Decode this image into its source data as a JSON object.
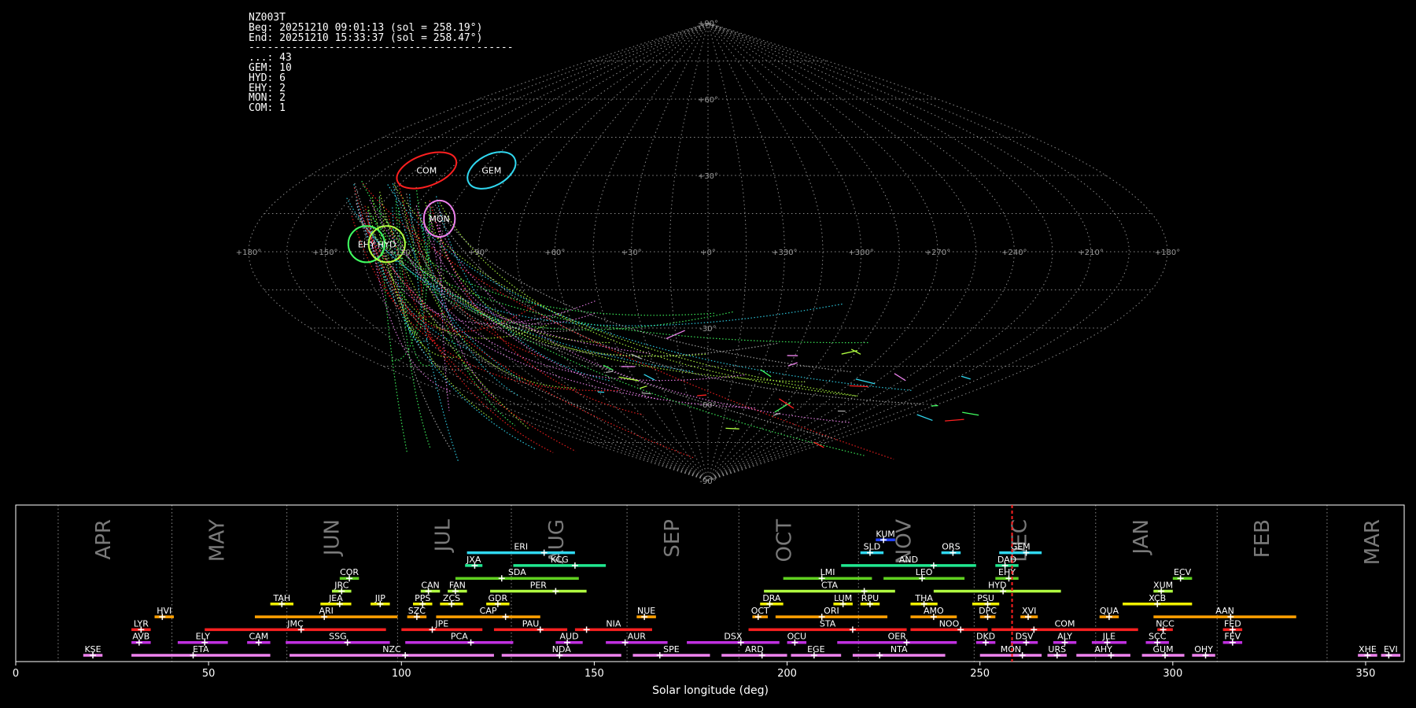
{
  "stats": {
    "camera": "NZ003T",
    "begin": "Beg: 20251210 09:01:13 (sol = 258.19°)",
    "end": "End: 20251210 15:33:37 (sol = 258.47°)",
    "separator": "-------------------------------------------",
    "counts": [
      {
        "label": "...: 43"
      },
      {
        "label": "GEM: 10"
      },
      {
        "label": "HYD: 6"
      },
      {
        "label": "EHY: 2"
      },
      {
        "label": "MON: 2"
      },
      {
        "label": "COM: 1"
      }
    ]
  },
  "chart_data": [
    {
      "type": "scatter",
      "projection": "sinusoidal",
      "lon_ticks": [
        {
          "lon": 180,
          "label": "+180°"
        },
        {
          "lon": 150,
          "label": "+150°"
        },
        {
          "lon": 120,
          "label": "+120°"
        },
        {
          "lon": 90,
          "label": "+90°"
        },
        {
          "lon": 60,
          "label": "+60°"
        },
        {
          "lon": 30,
          "label": "+30°"
        },
        {
          "lon": 0,
          "label": "+0°"
        },
        {
          "lon": -30,
          "label": "+330°"
        },
        {
          "lon": -60,
          "label": "+300°"
        },
        {
          "lon": -90,
          "label": "+270°"
        },
        {
          "lon": -120,
          "label": "+240°"
        },
        {
          "lon": -150,
          "label": "+210°"
        },
        {
          "lon": -180,
          "label": "+180°"
        }
      ],
      "lat_ticks": [
        {
          "lat": 90,
          "label": "+90°"
        },
        {
          "lat": 60,
          "label": "+60°"
        },
        {
          "lat": 30,
          "label": "+30°"
        },
        {
          "lat": -30,
          "label": "-30°"
        },
        {
          "lat": -60,
          "label": "-60°"
        },
        {
          "lat": -90,
          "label": "-90°"
        }
      ],
      "radiants": [
        {
          "name": "COM",
          "lon": 130,
          "lat": 32,
          "rx": 12,
          "ry": 6,
          "color": "#ff2020"
        },
        {
          "name": "GEM",
          "lon": 100,
          "lat": 32,
          "rx": 10,
          "ry": 6,
          "color": "#30d8f0"
        },
        {
          "name": "MON",
          "lon": 108,
          "lat": 13,
          "rx": 6,
          "ry": 7,
          "color": "#ee82ee"
        },
        {
          "name": "EHY",
          "lon": 134,
          "lat": 3,
          "rx": 7,
          "ry": 7,
          "color": "#40ff60"
        },
        {
          "name": "HYD",
          "lon": 126,
          "lat": 3,
          "rx": 7,
          "ry": 7,
          "color": "#b0ff40"
        }
      ],
      "meteor_colors": [
        "#30d8f0",
        "#b0ff40",
        "#40ff60",
        "#ee82ee",
        "#ff2020",
        "#aaaaaa"
      ]
    },
    {
      "type": "bar",
      "xlabel": "Solar longitude (deg)",
      "xlim": [
        0,
        360
      ],
      "x_ticks": [
        0,
        50,
        100,
        150,
        200,
        250,
        300,
        350
      ],
      "current_sol": 258.33,
      "months": [
        {
          "name": "APR",
          "start": 11
        },
        {
          "name": "MAY",
          "start": 40.5
        },
        {
          "name": "JUN",
          "start": 70.3
        },
        {
          "name": "JUL",
          "start": 99
        },
        {
          "name": "AUG",
          "start": 128.5
        },
        {
          "name": "SEP",
          "start": 158.5
        },
        {
          "name": "OCT",
          "start": 187.5
        },
        {
          "name": "NOV",
          "start": 218.5
        },
        {
          "name": "DEC",
          "start": 248.5
        },
        {
          "name": "JAN",
          "start": 280
        },
        {
          "name": "FEB",
          "start": 311.5
        },
        {
          "name": "MAR",
          "start": 340
        }
      ],
      "showers": [
        {
          "code": "KUM",
          "start": 223,
          "end": 228,
          "peak": 225,
          "row": 9,
          "color": "#2040ff"
        },
        {
          "code": "ERI",
          "start": 117,
          "end": 145,
          "peak": 137,
          "row": 8,
          "color": "#30d8f0"
        },
        {
          "code": "SLD",
          "start": 219,
          "end": 225,
          "peak": 221.5,
          "row": 8,
          "color": "#30d8f0"
        },
        {
          "code": "ORS",
          "start": 240,
          "end": 245,
          "peak": 243,
          "row": 8,
          "color": "#30d8f0"
        },
        {
          "code": "GEM",
          "start": 255,
          "end": 266,
          "peak": 262,
          "row": 8,
          "color": "#30d8f0"
        },
        {
          "code": "JXA",
          "start": 116.5,
          "end": 121,
          "peak": 119,
          "row": 7,
          "color": "#20e890"
        },
        {
          "code": "KCG",
          "start": 129,
          "end": 153,
          "peak": 145,
          "row": 7,
          "color": "#20e890"
        },
        {
          "code": "AND",
          "start": 214,
          "end": 249,
          "peak": 238,
          "row": 7,
          "color": "#20e890"
        },
        {
          "code": "DAD",
          "start": 254,
          "end": 260,
          "peak": 256.5,
          "row": 7,
          "color": "#20e890"
        },
        {
          "code": "COR",
          "start": 84,
          "end": 89,
          "peak": 86.5,
          "row": 6,
          "color": "#60d020"
        },
        {
          "code": "SDA",
          "start": 114,
          "end": 146,
          "peak": 126,
          "row": 6,
          "color": "#60d020"
        },
        {
          "code": "LMI",
          "start": 199,
          "end": 222,
          "peak": 209,
          "row": 6,
          "color": "#60d020"
        },
        {
          "code": "LEO",
          "start": 225,
          "end": 246,
          "peak": 235,
          "row": 6,
          "color": "#60d020"
        },
        {
          "code": "EHY",
          "start": 254,
          "end": 260,
          "peak": 257.5,
          "row": 6,
          "color": "#60d020"
        },
        {
          "code": "ECV",
          "start": 300,
          "end": 305,
          "peak": 302,
          "row": 6,
          "color": "#60d020"
        },
        {
          "code": "JRC",
          "start": 82,
          "end": 87,
          "peak": 84.5,
          "row": 5,
          "color": "#b0ff40"
        },
        {
          "code": "CAN",
          "start": 105,
          "end": 110,
          "peak": 107,
          "row": 5,
          "color": "#b0ff40"
        },
        {
          "code": "FAN",
          "start": 112,
          "end": 117,
          "peak": 114,
          "row": 5,
          "color": "#b0ff40"
        },
        {
          "code": "PER",
          "start": 123,
          "end": 148,
          "peak": 140,
          "row": 5,
          "color": "#b0ff40"
        },
        {
          "code": "CTA",
          "start": 194,
          "end": 228,
          "peak": 220,
          "row": 5,
          "color": "#b0ff40"
        },
        {
          "code": "HYD",
          "start": 238,
          "end": 271,
          "peak": 256,
          "row": 5,
          "color": "#b0ff40"
        },
        {
          "code": "XUM",
          "start": 295,
          "end": 300,
          "peak": 297,
          "row": 5,
          "color": "#b0ff40"
        },
        {
          "code": "TAH",
          "start": 66,
          "end": 72,
          "peak": 69,
          "row": 4,
          "color": "#f0f000"
        },
        {
          "code": "JEA",
          "start": 79,
          "end": 87,
          "peak": 84,
          "row": 4,
          "color": "#f0f000"
        },
        {
          "code": "JIP",
          "start": 92,
          "end": 97,
          "peak": 94.5,
          "row": 4,
          "color": "#f0f000"
        },
        {
          "code": "PPS",
          "start": 103,
          "end": 108,
          "peak": 105.5,
          "row": 4,
          "color": "#f0f000"
        },
        {
          "code": "ZCS",
          "start": 110,
          "end": 116,
          "peak": 113,
          "row": 4,
          "color": "#f0f000"
        },
        {
          "code": "GDR",
          "start": 122,
          "end": 128,
          "peak": 125,
          "row": 4,
          "color": "#f0f000"
        },
        {
          "code": "DRA",
          "start": 193,
          "end": 199,
          "peak": 195.5,
          "row": 4,
          "color": "#f0f000"
        },
        {
          "code": "LUM",
          "start": 212,
          "end": 217,
          "peak": 214.5,
          "row": 4,
          "color": "#f0f000"
        },
        {
          "code": "RPU",
          "start": 219,
          "end": 224,
          "peak": 221.5,
          "row": 4,
          "color": "#f0f000"
        },
        {
          "code": "THA",
          "start": 232,
          "end": 239,
          "peak": 235.5,
          "row": 4,
          "color": "#f0f000"
        },
        {
          "code": "PSU",
          "start": 248,
          "end": 255,
          "peak": 252,
          "row": 4,
          "color": "#f0f000"
        },
        {
          "code": "XCB",
          "start": 287,
          "end": 305,
          "peak": 296,
          "row": 4,
          "color": "#f0f000"
        },
        {
          "code": "HVI",
          "start": 36,
          "end": 41,
          "peak": 38,
          "row": 3,
          "color": "#ffa000"
        },
        {
          "code": "ARI",
          "start": 62,
          "end": 99,
          "peak": 80,
          "row": 3,
          "color": "#ffa000"
        },
        {
          "code": "SZC",
          "start": 101.5,
          "end": 106.5,
          "peak": 104,
          "row": 3,
          "color": "#ffa000"
        },
        {
          "code": "CAP",
          "start": 109,
          "end": 136,
          "peak": 127,
          "row": 3,
          "color": "#ffa000"
        },
        {
          "code": "NUE",
          "start": 161,
          "end": 166,
          "peak": 163,
          "row": 3,
          "color": "#ffa000"
        },
        {
          "code": "OCT",
          "start": 191,
          "end": 195,
          "peak": 192.5,
          "row": 3,
          "color": "#ffa000"
        },
        {
          "code": "ORI",
          "start": 197,
          "end": 226,
          "peak": 209,
          "row": 3,
          "color": "#ffa000"
        },
        {
          "code": "AMO",
          "start": 232,
          "end": 244,
          "peak": 238,
          "row": 3,
          "color": "#ffa000"
        },
        {
          "code": "DPC",
          "start": 250,
          "end": 254,
          "peak": 252,
          "row": 3,
          "color": "#ffa000"
        },
        {
          "code": "XVI",
          "start": 260.5,
          "end": 265,
          "peak": 262.5,
          "row": 3,
          "color": "#ffa000"
        },
        {
          "code": "QUA",
          "start": 281,
          "end": 286,
          "peak": 283.5,
          "row": 3,
          "color": "#ffa000"
        },
        {
          "code": "AAN",
          "start": 295,
          "end": 332,
          "peak": 315,
          "row": 3,
          "color": "#ffa000"
        },
        {
          "code": "LYR",
          "start": 30,
          "end": 35,
          "peak": 32.5,
          "row": 2,
          "color": "#ff2020"
        },
        {
          "code": "JMC",
          "start": 49,
          "end": 96,
          "peak": 74,
          "row": 2,
          "color": "#ff2020"
        },
        {
          "code": "JPE",
          "start": 100,
          "end": 121,
          "peak": 108,
          "row": 2,
          "color": "#ff2020"
        },
        {
          "code": "PAU",
          "start": 124,
          "end": 143,
          "peak": 136,
          "row": 2,
          "color": "#ff2020"
        },
        {
          "code": "NIA",
          "start": 145,
          "end": 165,
          "peak": 148,
          "row": 2,
          "color": "#ff2020"
        },
        {
          "code": "STA",
          "start": 190,
          "end": 231,
          "peak": 217,
          "row": 2,
          "color": "#ff2020"
        },
        {
          "code": "NOO",
          "start": 232,
          "end": 252,
          "peak": 245,
          "row": 2,
          "color": "#ff2020"
        },
        {
          "code": "COM",
          "start": 253,
          "end": 291,
          "peak": 264,
          "row": 2,
          "color": "#ff2020"
        },
        {
          "code": "NCC",
          "start": 296,
          "end": 300,
          "peak": 297.5,
          "row": 2,
          "color": "#ff2020"
        },
        {
          "code": "FED",
          "start": 313,
          "end": 318,
          "peak": 315.5,
          "row": 2,
          "color": "#ff2020"
        },
        {
          "code": "AVB",
          "start": 30,
          "end": 35,
          "peak": 32,
          "row": 1,
          "color": "#c030e0"
        },
        {
          "code": "ELY",
          "start": 42,
          "end": 55,
          "peak": 49,
          "row": 1,
          "color": "#c030e0"
        },
        {
          "code": "CAM",
          "start": 60,
          "end": 66,
          "peak": 63,
          "row": 1,
          "color": "#c030e0"
        },
        {
          "code": "SSG",
          "start": 70,
          "end": 97,
          "peak": 86,
          "row": 1,
          "color": "#c030e0"
        },
        {
          "code": "PCA",
          "start": 101,
          "end": 129,
          "peak": 118,
          "row": 1,
          "color": "#c030e0"
        },
        {
          "code": "AUD",
          "start": 140,
          "end": 147,
          "peak": 143,
          "row": 1,
          "color": "#c030e0"
        },
        {
          "code": "AUR",
          "start": 153,
          "end": 169,
          "peak": 158,
          "row": 1,
          "color": "#c030e0"
        },
        {
          "code": "DSX",
          "start": 174,
          "end": 198,
          "peak": 188,
          "row": 1,
          "color": "#c030e0"
        },
        {
          "code": "OCU",
          "start": 200,
          "end": 205,
          "peak": 202,
          "row": 1,
          "color": "#c030e0"
        },
        {
          "code": "OER",
          "start": 213,
          "end": 244,
          "peak": 231,
          "row": 1,
          "color": "#c030e0"
        },
        {
          "code": "DKD",
          "start": 249,
          "end": 254,
          "peak": 251.5,
          "row": 1,
          "color": "#c030e0"
        },
        {
          "code": "DSV",
          "start": 258,
          "end": 265,
          "peak": 262,
          "row": 1,
          "color": "#c030e0"
        },
        {
          "code": "ALY",
          "start": 269,
          "end": 275,
          "peak": 272,
          "row": 1,
          "color": "#c030e0"
        },
        {
          "code": "JLE",
          "start": 279,
          "end": 288,
          "peak": 283,
          "row": 1,
          "color": "#c030e0"
        },
        {
          "code": "SCC",
          "start": 293,
          "end": 299,
          "peak": 296,
          "row": 1,
          "color": "#c030e0"
        },
        {
          "code": "FEV",
          "start": 313,
          "end": 318,
          "peak": 315.5,
          "row": 1,
          "color": "#c030e0"
        },
        {
          "code": "KSE",
          "start": 17.5,
          "end": 22.5,
          "peak": 20,
          "row": 0,
          "color": "#ee82ee"
        },
        {
          "code": "ETA",
          "start": 30,
          "end": 66,
          "peak": 46,
          "row": 0,
          "color": "#ee82ee"
        },
        {
          "code": "NZC",
          "start": 71,
          "end": 124,
          "peak": 101,
          "row": 0,
          "color": "#ee82ee"
        },
        {
          "code": "NDA",
          "start": 126,
          "end": 157,
          "peak": 141,
          "row": 0,
          "color": "#ee82ee"
        },
        {
          "code": "SPE",
          "start": 160,
          "end": 180,
          "peak": 167,
          "row": 0,
          "color": "#ee82ee"
        },
        {
          "code": "ARD",
          "start": 183,
          "end": 200,
          "peak": 193.5,
          "row": 0,
          "color": "#ee82ee"
        },
        {
          "code": "EGE",
          "start": 201,
          "end": 214,
          "peak": 207,
          "row": 0,
          "color": "#ee82ee"
        },
        {
          "code": "NTA",
          "start": 217,
          "end": 241,
          "peak": 224,
          "row": 0,
          "color": "#ee82ee"
        },
        {
          "code": "MON",
          "start": 250,
          "end": 266,
          "peak": 261,
          "row": 0,
          "color": "#ee82ee"
        },
        {
          "code": "URS",
          "start": 267.5,
          "end": 272.5,
          "peak": 270,
          "row": 0,
          "color": "#ee82ee"
        },
        {
          "code": "AHY",
          "start": 275,
          "end": 289,
          "peak": 284,
          "row": 0,
          "color": "#ee82ee"
        },
        {
          "code": "GUM",
          "start": 292,
          "end": 303,
          "peak": 298,
          "row": 0,
          "color": "#ee82ee"
        },
        {
          "code": "OHY",
          "start": 305,
          "end": 311,
          "peak": 308.5,
          "row": 0,
          "color": "#ee82ee"
        },
        {
          "code": "XHE",
          "start": 348,
          "end": 353,
          "peak": 350.5,
          "row": 0,
          "color": "#ee82ee"
        },
        {
          "code": "EVI",
          "start": 354,
          "end": 359,
          "peak": 356,
          "row": 0,
          "color": "#ee82ee"
        }
      ]
    }
  ]
}
